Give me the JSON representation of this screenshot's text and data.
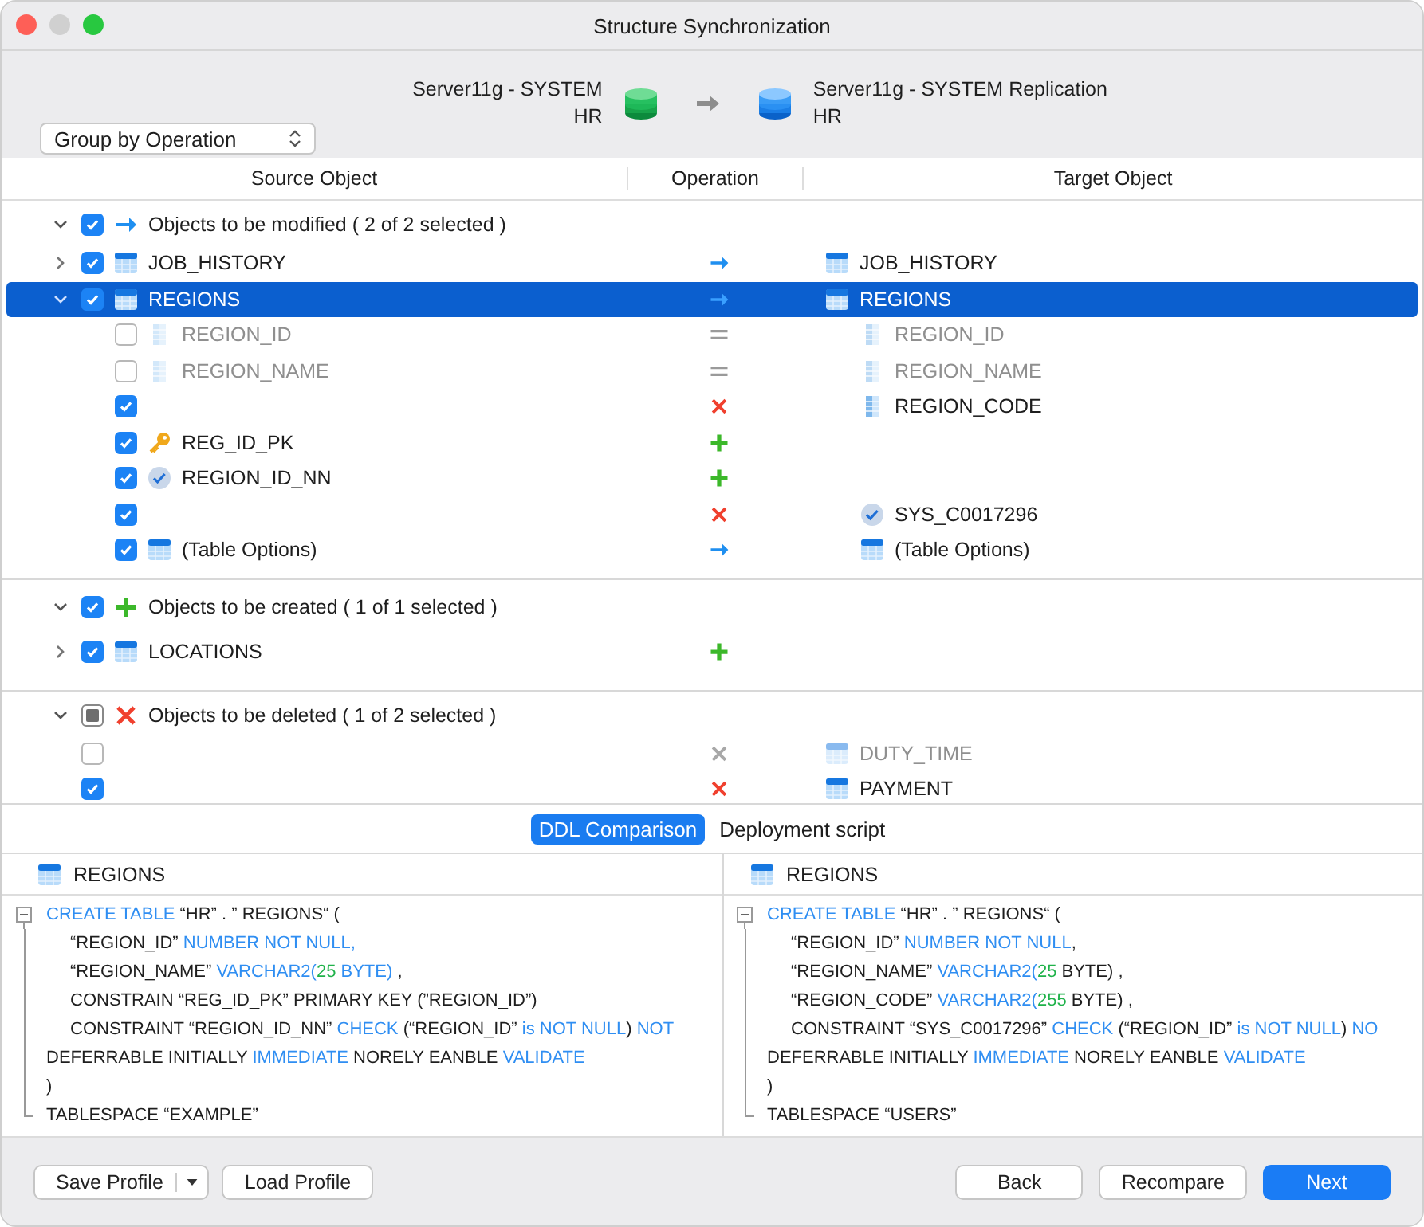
{
  "window": {
    "title": "Structure Synchronization"
  },
  "source": {
    "server": "Server11g - SYSTEM",
    "schema": "HR"
  },
  "target": {
    "server": "Server11g - SYSTEM Replication",
    "schema": "HR"
  },
  "group_by": {
    "value": "Group by Operation"
  },
  "columns": [
    "Source Object",
    "Operation",
    "Target Object"
  ],
  "groups": [
    {
      "kind": "modify",
      "label": "Objects to be modified ( 2 of 2 selected )",
      "checked": true,
      "mixed": false,
      "expanded": true,
      "items": [
        {
          "source": {
            "kind": "table",
            "name": "JOB_HISTORY"
          },
          "kind": "modify",
          "target": {
            "kind": "table",
            "name": "JOB_HISTORY"
          },
          "checked": true,
          "selected": false,
          "expanded": false
        },
        {
          "source": {
            "kind": "table",
            "name": "REGIONS"
          },
          "kind": "modify",
          "target": {
            "kind": "table",
            "name": "REGIONS"
          },
          "checked": true,
          "selected": true,
          "expanded": true,
          "children": [
            {
              "source": {
                "kind": "column",
                "name": "REGION_ID"
              },
              "kind": "same",
              "target": {
                "kind": "column",
                "name": "REGION_ID"
              },
              "checked": false,
              "selected": false
            },
            {
              "source": {
                "kind": "column",
                "name": "REGION_NAME"
              },
              "kind": "same",
              "target": {
                "kind": "column",
                "name": "REGION_NAME"
              },
              "checked": false,
              "selected": false
            },
            {
              "kind": "delete",
              "target": {
                "kind": "column",
                "name": "REGION_CODE"
              },
              "checked": true,
              "selected": false
            },
            {
              "source": {
                "kind": "key",
                "name": "REG_ID_PK"
              },
              "kind": "create",
              "checked": true,
              "selected": false
            },
            {
              "source": {
                "kind": "check",
                "name": "REGION_ID_NN"
              },
              "kind": "create",
              "checked": true,
              "selected": false
            },
            {
              "kind": "delete",
              "target": {
                "kind": "check",
                "name": "SYS_C0017296"
              },
              "checked": true,
              "selected": false
            },
            {
              "source": {
                "kind": "table",
                "name": "(Table Options)"
              },
              "kind": "modify",
              "target": {
                "kind": "table",
                "name": "(Table Options)"
              },
              "checked": true,
              "selected": false
            }
          ]
        }
      ]
    },
    {
      "kind": "create",
      "label": "Objects to be created ( 1 of 1 selected )",
      "checked": true,
      "mixed": false,
      "expanded": true,
      "items": [
        {
          "source": {
            "kind": "table",
            "name": "LOCATIONS"
          },
          "kind": "create",
          "checked": true,
          "selected": false,
          "expanded": false
        }
      ]
    },
    {
      "kind": "delete",
      "label": "Objects to be deleted ( 1 of 2 selected )",
      "checked": false,
      "mixed": true,
      "expanded": true,
      "items": [
        {
          "kind": "delete",
          "target": {
            "kind": "table",
            "name": "DUTY_TIME"
          },
          "checked": false,
          "selected": false
        },
        {
          "kind": "delete",
          "target": {
            "kind": "table",
            "name": "PAYMENT"
          },
          "checked": true,
          "selected": false
        }
      ]
    }
  ],
  "tabs": [
    {
      "label": "DDL Comparison",
      "selected": true
    },
    {
      "label": "Deployment script",
      "selected": false
    }
  ],
  "panes": [
    {
      "title": "REGIONS",
      "lines": [
        {
          "indented": false,
          "segments": [
            {
              "text": "CREATE TABLE",
              "kind": "kw"
            },
            {
              "text": " “HR” . ” REGIONS“ (",
              "kind": "plain"
            }
          ]
        },
        {
          "indented": true,
          "segments": [
            {
              "text": "“REGION_ID” ",
              "kind": "plain"
            },
            {
              "text": "NUMBER NOT NULL,",
              "kind": "kw"
            }
          ]
        },
        {
          "indented": true,
          "segments": [
            {
              "text": "“REGION_NAME” ",
              "kind": "plain"
            },
            {
              "text": "VARCHAR2(",
              "kind": "kw"
            },
            {
              "text": "25",
              "kind": "num"
            },
            {
              "text": " BYTE)",
              "kind": "kw"
            },
            {
              "text": " ,",
              "kind": "plain"
            }
          ]
        },
        {
          "indented": true,
          "segments": [
            {
              "text": "CONSTRAIN “REG_ID_PK” PRIMARY KEY (”REGION_ID”)",
              "kind": "plain"
            }
          ]
        },
        {
          "indented": true,
          "segments": [
            {
              "text": "CONSTRAINT “REGION_ID_NN” ",
              "kind": "plain"
            },
            {
              "text": "CHECK",
              "kind": "kw"
            },
            {
              "text": " (“REGION_ID” ",
              "kind": "plain"
            },
            {
              "text": "is NOT NULL",
              "kind": "kw"
            },
            {
              "text": ") ",
              "kind": "plain"
            },
            {
              "text": "NOT",
              "kind": "kw"
            }
          ]
        },
        {
          "indented": false,
          "segments": [
            {
              "text": "DEFERRABLE INITIALLY ",
              "kind": "plain"
            },
            {
              "text": "IMMEDIATE",
              "kind": "kw"
            },
            {
              "text": " NORELY EANBLE ",
              "kind": "plain"
            },
            {
              "text": "VALIDATE",
              "kind": "kw"
            }
          ]
        },
        {
          "indented": false,
          "segments": [
            {
              "text": ")",
              "kind": "plain"
            }
          ]
        },
        {
          "indented": false,
          "segments": [
            {
              "text": "TABLESPACE “EXAMPLE”",
              "kind": "plain"
            }
          ]
        }
      ]
    },
    {
      "title": "REGIONS",
      "lines": [
        {
          "indented": false,
          "segments": [
            {
              "text": "CREATE TABLE",
              "kind": "kw"
            },
            {
              "text": " “HR” . ” REGIONS“ (",
              "kind": "plain"
            }
          ]
        },
        {
          "indented": true,
          "segments": [
            {
              "text": "“REGION_ID” ",
              "kind": "plain"
            },
            {
              "text": "NUMBER NOT NULL",
              "kind": "kw"
            },
            {
              "text": ",",
              "kind": "plain"
            }
          ]
        },
        {
          "indented": true,
          "segments": [
            {
              "text": "“REGION_NAME” ",
              "kind": "plain"
            },
            {
              "text": "VARCHAR2(",
              "kind": "kw"
            },
            {
              "text": "25",
              "kind": "num"
            },
            {
              "text": " BYTE) ,",
              "kind": "plain"
            }
          ]
        },
        {
          "indented": true,
          "segments": [
            {
              "text": "“REGION_CODE” ",
              "kind": "plain"
            },
            {
              "text": "VARCHAR2(",
              "kind": "kw"
            },
            {
              "text": "255",
              "kind": "num"
            },
            {
              "text": " BYTE) ,",
              "kind": "plain"
            }
          ]
        },
        {
          "indented": true,
          "segments": [
            {
              "text": "CONSTRAINT “SYS_C0017296” ",
              "kind": "plain"
            },
            {
              "text": "CHECK",
              "kind": "kw"
            },
            {
              "text": " (“REGION_ID” ",
              "kind": "plain"
            },
            {
              "text": "is NOT NULL",
              "kind": "kw"
            },
            {
              "text": ") ",
              "kind": "plain"
            },
            {
              "text": "NO",
              "kind": "kw"
            }
          ]
        },
        {
          "indented": false,
          "segments": [
            {
              "text": "DEFERRABLE INITIALLY ",
              "kind": "plain"
            },
            {
              "text": "IMMEDIATE",
              "kind": "kw"
            },
            {
              "text": " NORELY EANBLE ",
              "kind": "plain"
            },
            {
              "text": "VALIDATE",
              "kind": "kw"
            }
          ]
        },
        {
          "indented": false,
          "segments": [
            {
              "text": ")",
              "kind": "plain"
            }
          ]
        },
        {
          "indented": false,
          "segments": [
            {
              "text": "TABLESPACE “USERS”",
              "kind": "plain"
            }
          ]
        }
      ]
    }
  ],
  "footer": {
    "left": [
      {
        "label": "Save Profile",
        "kind": "split"
      },
      {
        "label": "Load Profile",
        "kind": "plain"
      }
    ],
    "right": [
      {
        "label": "Back",
        "kind": "plain"
      },
      {
        "label": "Recompare",
        "kind": "plain"
      },
      {
        "label": "Next",
        "kind": "primary"
      }
    ]
  }
}
